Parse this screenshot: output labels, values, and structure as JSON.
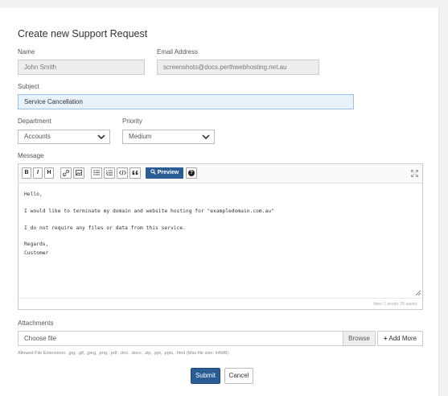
{
  "form": {
    "heading": "Create new Support Request",
    "name_label": "Name",
    "name_value": "John Smith",
    "email_label": "Email Address",
    "email_value": "screenshots@docs.perthwebhosting.net.au",
    "subject_label": "Subject",
    "subject_value": "Service Cancellation",
    "department_label": "Department",
    "department_value": "Accounts",
    "priority_label": "Priority",
    "priority_value": "Medium",
    "message_label": "Message"
  },
  "toolbar": {
    "bold": "B",
    "italic": "I",
    "heading": "H",
    "preview": "Preview",
    "help": "?"
  },
  "editor": {
    "content": "Hello,\n\nI would like to terminate my domain and website hosting for \"exampledomain.com.au\"\n\nI do not require any files or data from this service.\n\nRegards,\nCustomer",
    "status": "lines: 1   words: 26   saved"
  },
  "attachments": {
    "label": "Attachments",
    "placeholder": "Choose file",
    "browse_label": "Browse",
    "add_more_label": "Add More",
    "hint": "Allowed File Extensions: .jpg, .gif, .jpeg, .png, .pdf, .doc, .docx, .zip, .ppt, .pptx, .html (Max file size: 64MB)"
  },
  "actions": {
    "submit_label": "Submit",
    "cancel_label": "Cancel"
  },
  "colors": {
    "primary": "#2a5d94",
    "subject_bg": "#e9f1fb"
  }
}
